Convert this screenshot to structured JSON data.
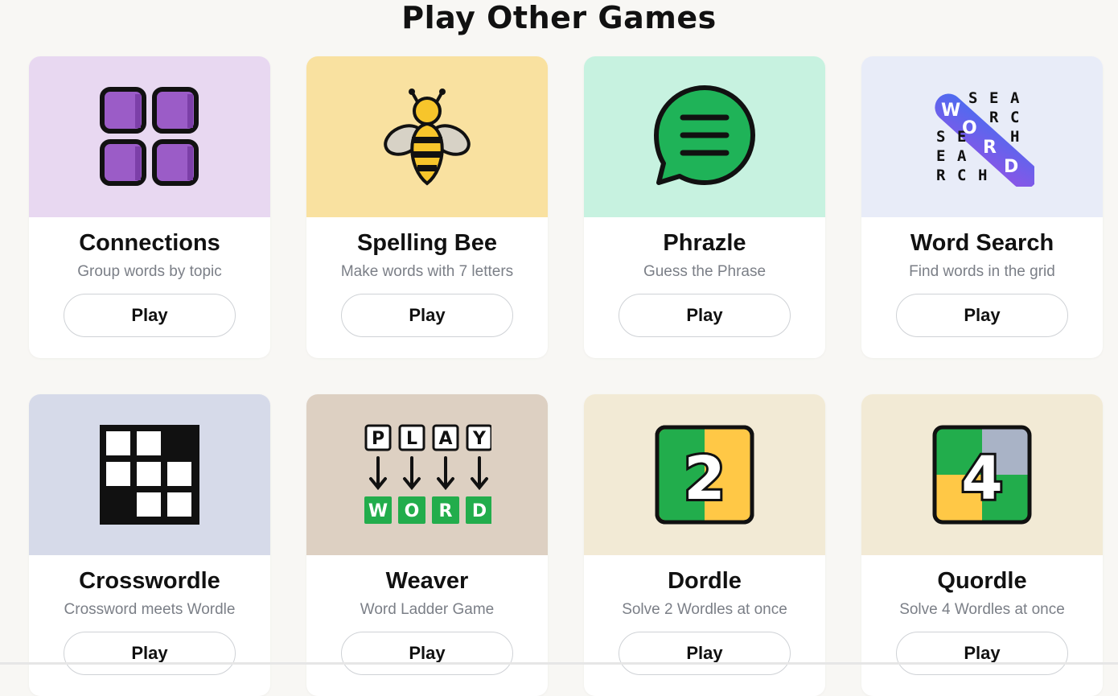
{
  "page": {
    "title": "Play Other Games"
  },
  "games": [
    {
      "name": "Connections",
      "description": "Group words by topic",
      "play_label": "Play",
      "bg": "#e8d8f1",
      "icon": "connections-grid-icon"
    },
    {
      "name": "Spelling Bee",
      "description": "Make words with 7 letters",
      "play_label": "Play",
      "bg": "#f9e1a0",
      "icon": "bee-icon"
    },
    {
      "name": "Phrazle",
      "description": "Guess the Phrase",
      "play_label": "Play",
      "bg": "#c7f2e0",
      "icon": "speech-bubble-icon"
    },
    {
      "name": "Word Search",
      "description": "Find words in the grid",
      "play_label": "Play",
      "bg": "#e8ecf8",
      "icon": "word-search-icon",
      "icon_text": {
        "w": "W",
        "o": "O",
        "r": "R",
        "d": "D",
        "row1": "S E A",
        "row2": "R C",
        "row3": "E   H",
        "row4": "S",
        "row5": "E A",
        "row6": "R C H",
        "col_s": "S",
        "col_e": "E",
        "col_r": "R"
      }
    },
    {
      "name": "Crosswordle",
      "description": "Crossword meets Wordle",
      "play_label": "Play",
      "bg": "#d6dae9",
      "icon": "crossword-grid-icon"
    },
    {
      "name": "Weaver",
      "description": "Word Ladder Game",
      "play_label": "Play",
      "bg": "#ddd0c2",
      "icon": "word-ladder-icon",
      "icon_text": {
        "top": [
          "P",
          "L",
          "A",
          "Y"
        ],
        "bottom": [
          "W",
          "O",
          "R",
          "D"
        ]
      }
    },
    {
      "name": "Dordle",
      "description": "Solve 2 Wordles at once",
      "play_label": "Play",
      "bg": "#f2ead5",
      "icon": "dordle-2-icon",
      "icon_text": {
        "digit": "2"
      }
    },
    {
      "name": "Quordle",
      "description": "Solve 4 Wordles at once",
      "play_label": "Play",
      "bg": "#f2ead5",
      "icon": "quordle-4-icon",
      "icon_text": {
        "digit": "4"
      }
    }
  ],
  "colors": {
    "green": "#22ad4c",
    "yellow": "#ffc846",
    "purple": "#9b5cc7",
    "grey_tile": "#a9b3c6"
  }
}
